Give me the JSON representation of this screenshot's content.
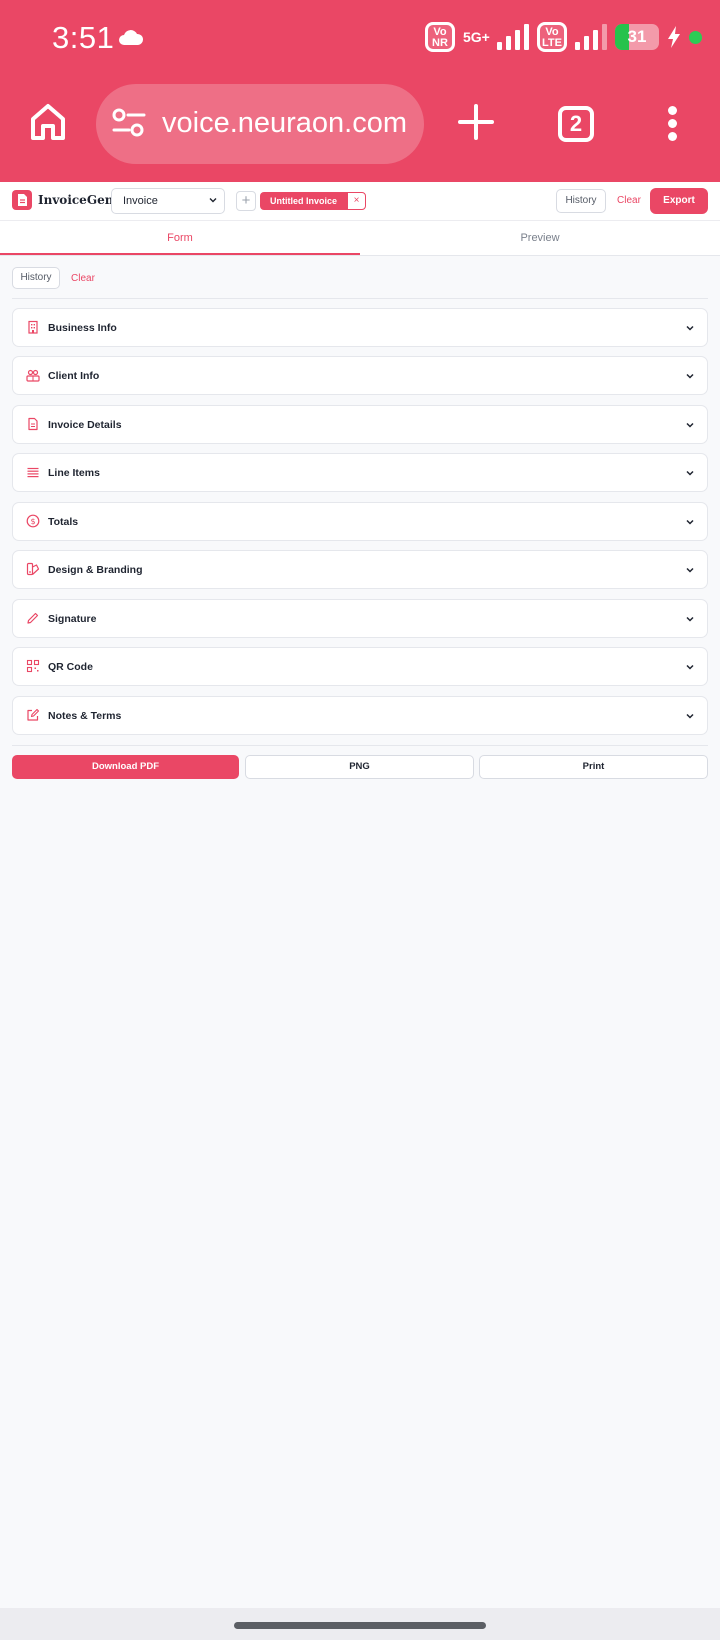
{
  "status": {
    "time": "3:51",
    "net_vonr": "Vo NR",
    "net_5g": "5G+",
    "net_volte": "Vo LTE",
    "battery": "31",
    "battery_level": 0.31
  },
  "browser": {
    "url": "voice.neuraon.com",
    "tab_count": "2"
  },
  "app": {
    "name": "InvoiceGen",
    "doc_type": "Invoice",
    "doc_tab": "Untitled Invoice",
    "doc_tab_close": "×",
    "add_tab": "+",
    "history": "History",
    "clear": "Clear",
    "export": "Export"
  },
  "view_tabs": [
    {
      "label": "Form",
      "active": true
    },
    {
      "label": "Preview",
      "active": false
    }
  ],
  "form": {
    "history": "History",
    "clear": "Clear",
    "sections": [
      {
        "label": "Business Info",
        "icon": "building-icon"
      },
      {
        "label": "Client Info",
        "icon": "users-icon"
      },
      {
        "label": "Invoice Details",
        "icon": "document-icon"
      },
      {
        "label": "Line Items",
        "icon": "list-icon"
      },
      {
        "label": "Totals",
        "icon": "dollar-icon"
      },
      {
        "label": "Design & Branding",
        "icon": "palette-icon"
      },
      {
        "label": "Signature",
        "icon": "pen-icon"
      },
      {
        "label": "QR Code",
        "icon": "qr-code-icon"
      },
      {
        "label": "Notes & Terms",
        "icon": "edit-icon"
      }
    ],
    "download_pdf": "Download PDF",
    "png": "PNG",
    "print": "Print"
  },
  "colors": {
    "brand": "#ea4765",
    "background": "#f8f9fb"
  }
}
